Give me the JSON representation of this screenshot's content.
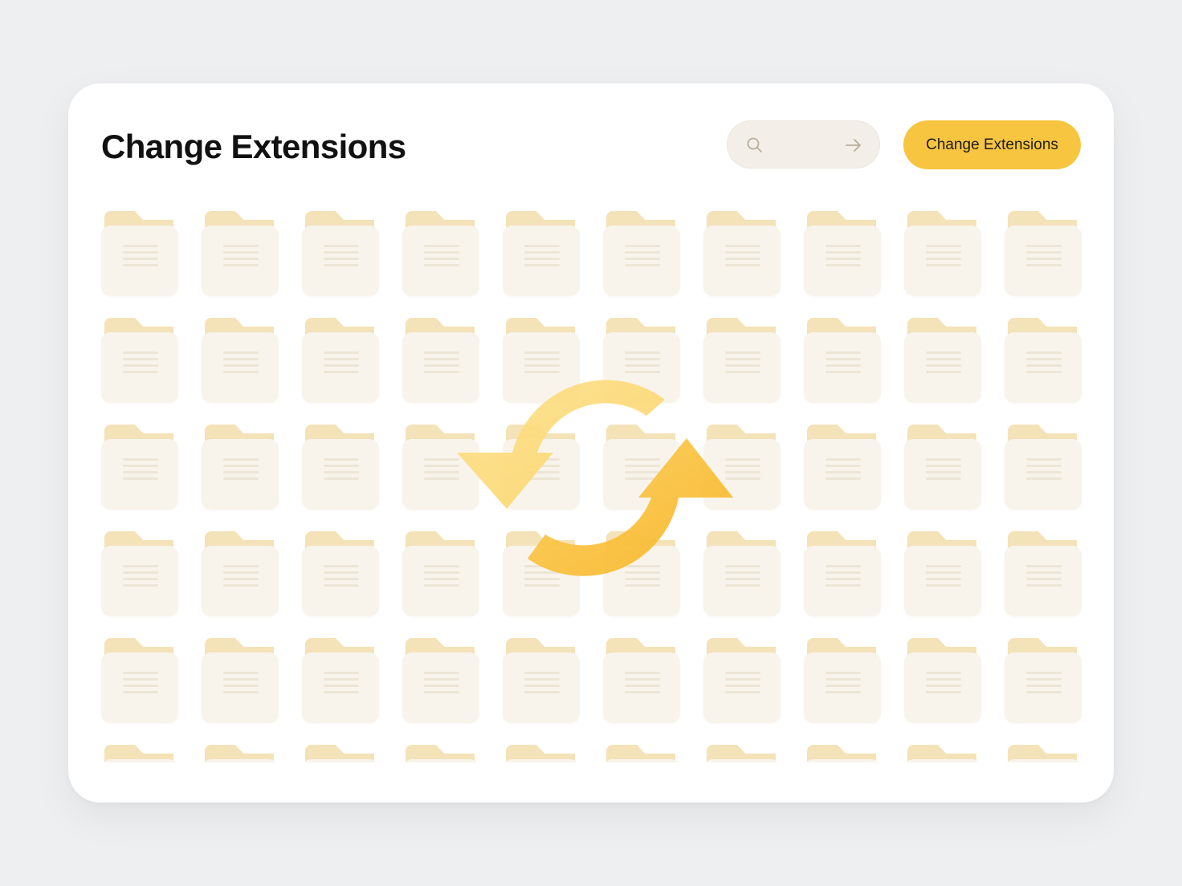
{
  "header": {
    "title": "Change Extensions",
    "search_placeholder": ""
  },
  "actions": {
    "primary_label": "Change Extensions"
  },
  "icons": {
    "search": "search-icon",
    "go": "arrow-right-icon",
    "sync": "sync-arrows-icon",
    "folder": "folder-icon"
  },
  "colors": {
    "accent": "#f8c540",
    "folder_tab": "#f4e2b8",
    "folder_body": "#f8f4ec",
    "sync_light": "#fbdc7a",
    "sync_dark": "#f8b92e"
  },
  "folder_grid": {
    "columns": 10,
    "rows": 6
  }
}
